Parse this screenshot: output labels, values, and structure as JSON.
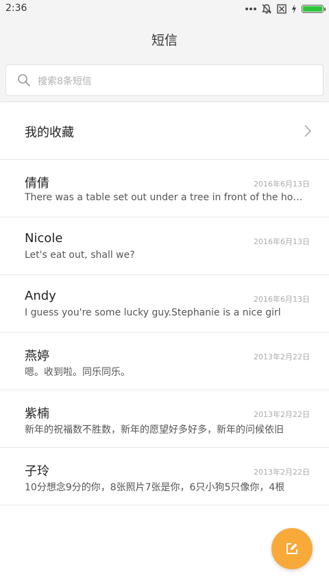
{
  "status_bar": {
    "time": "2:36",
    "icons": [
      "more-dots-icon",
      "bell-muted-icon",
      "no-sim-icon",
      "charging-bolt-icon",
      "battery-icon"
    ],
    "battery_color": "#2ec53b",
    "battery_level": 1.0
  },
  "header": {
    "title": "短信"
  },
  "search": {
    "placeholder": "搜索8条短信",
    "icon": "search-icon"
  },
  "favorites": {
    "label": "我的收藏",
    "icon": "chevron-right-icon"
  },
  "conversations": [
    {
      "name": "倩倩",
      "date": "2016年6月13日",
      "preview": "There was a table set out under a tree in front of the house, and the March Hare and the Hatter were having tea at it"
    },
    {
      "name": "Nicole",
      "date": "2016年6月13日",
      "preview": "Let's eat out, shall we?"
    },
    {
      "name": "Andy",
      "date": "2016年6月13日",
      "preview": "I guess you're some lucky guy.Stephanie is a nice girl"
    },
    {
      "name": "燕婷",
      "date": "2013年2月22日",
      "preview": "嗯。收到啦。同乐同乐。"
    },
    {
      "name": "紫楠",
      "date": "2013年2月22日",
      "preview": "新年的祝福数不胜数，新年的愿望好多好多，新年的问候依旧"
    },
    {
      "name": "子玲",
      "date": "2013年2月22日",
      "preview": "10分想念9分的你，8张照片7张是你，6只小狗5只像你，4根"
    }
  ],
  "fab": {
    "icon": "compose-icon",
    "color": "#f7a93a"
  }
}
